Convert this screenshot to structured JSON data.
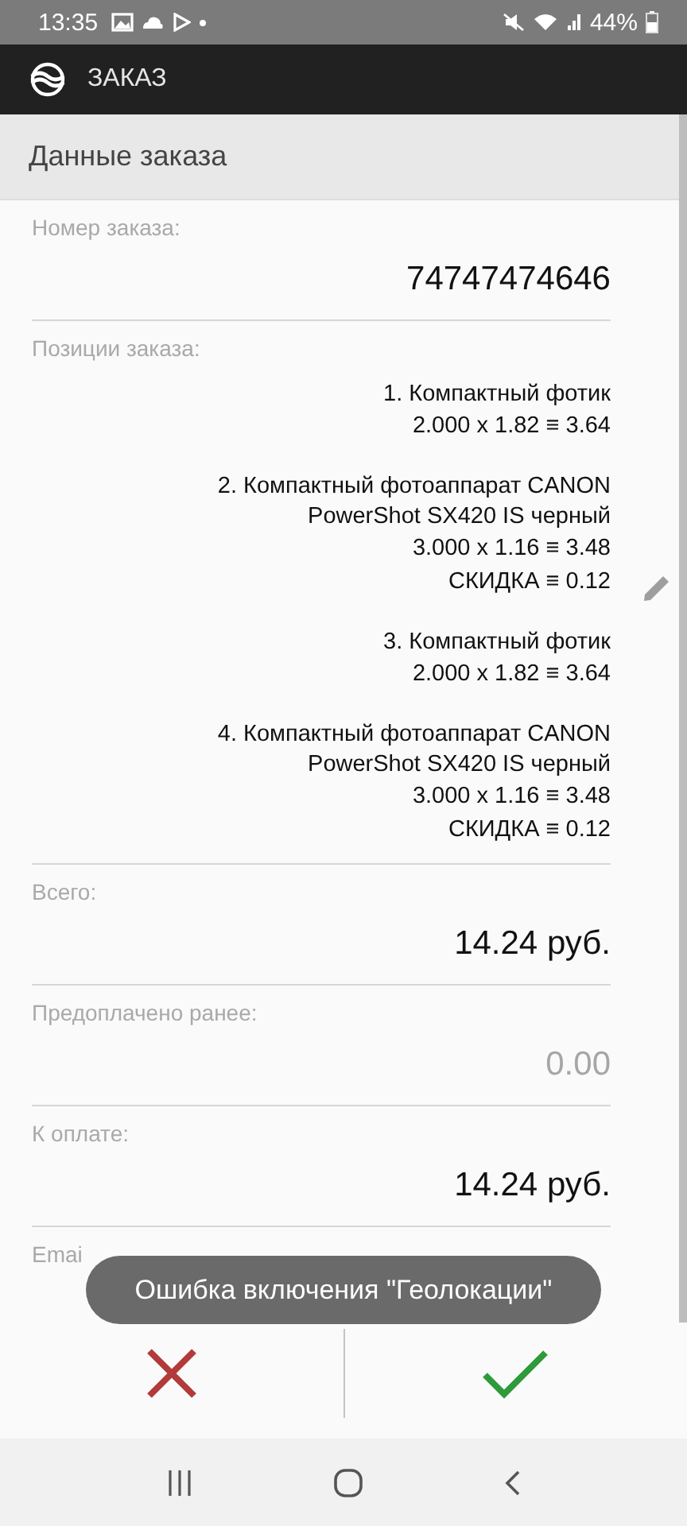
{
  "status_bar": {
    "time": "13:35",
    "battery": "44%"
  },
  "app_bar": {
    "title": "ЗАКАЗ"
  },
  "section": {
    "title": "Данные заказа"
  },
  "fields": [
    {
      "kind": "value",
      "label": "Номер заказа:",
      "value": "74747474646",
      "disabled": false
    },
    {
      "kind": "items",
      "label": "Позиции заказа:",
      "items": [
        {
          "name": "1. Компактный фотик",
          "calc": "2.000 x 1.82 ≡ 3.64"
        },
        {
          "name": "2. Компактный фотоаппарат CANON PowerShot SX420 IS черный",
          "calc": "3.000 x 1.16 ≡ 3.48",
          "discount": "СКИДКА ≡ 0.12"
        },
        {
          "name": "3. Компактный фотик",
          "calc": "2.000 x 1.82 ≡ 3.64"
        },
        {
          "name": "4. Компактный фотоаппарат CANON PowerShot SX420 IS черный",
          "calc": "3.000 x 1.16 ≡ 3.48",
          "discount": "СКИДКА ≡ 0.12"
        }
      ]
    },
    {
      "kind": "value",
      "label": "Всего:",
      "value": "14.24 руб.",
      "disabled": false
    },
    {
      "kind": "value",
      "label": "Предоплачено ранее:",
      "value": "0.00",
      "disabled": true
    },
    {
      "kind": "value",
      "label": "К оплате:",
      "value": "14.24 руб.",
      "disabled": false
    },
    {
      "kind": "label",
      "label": "Emai"
    }
  ],
  "actions": [
    {
      "kind": "cancel"
    },
    {
      "kind": "confirm"
    }
  ],
  "toast": {
    "text": "Ошибка включения \"Геолокации\""
  }
}
